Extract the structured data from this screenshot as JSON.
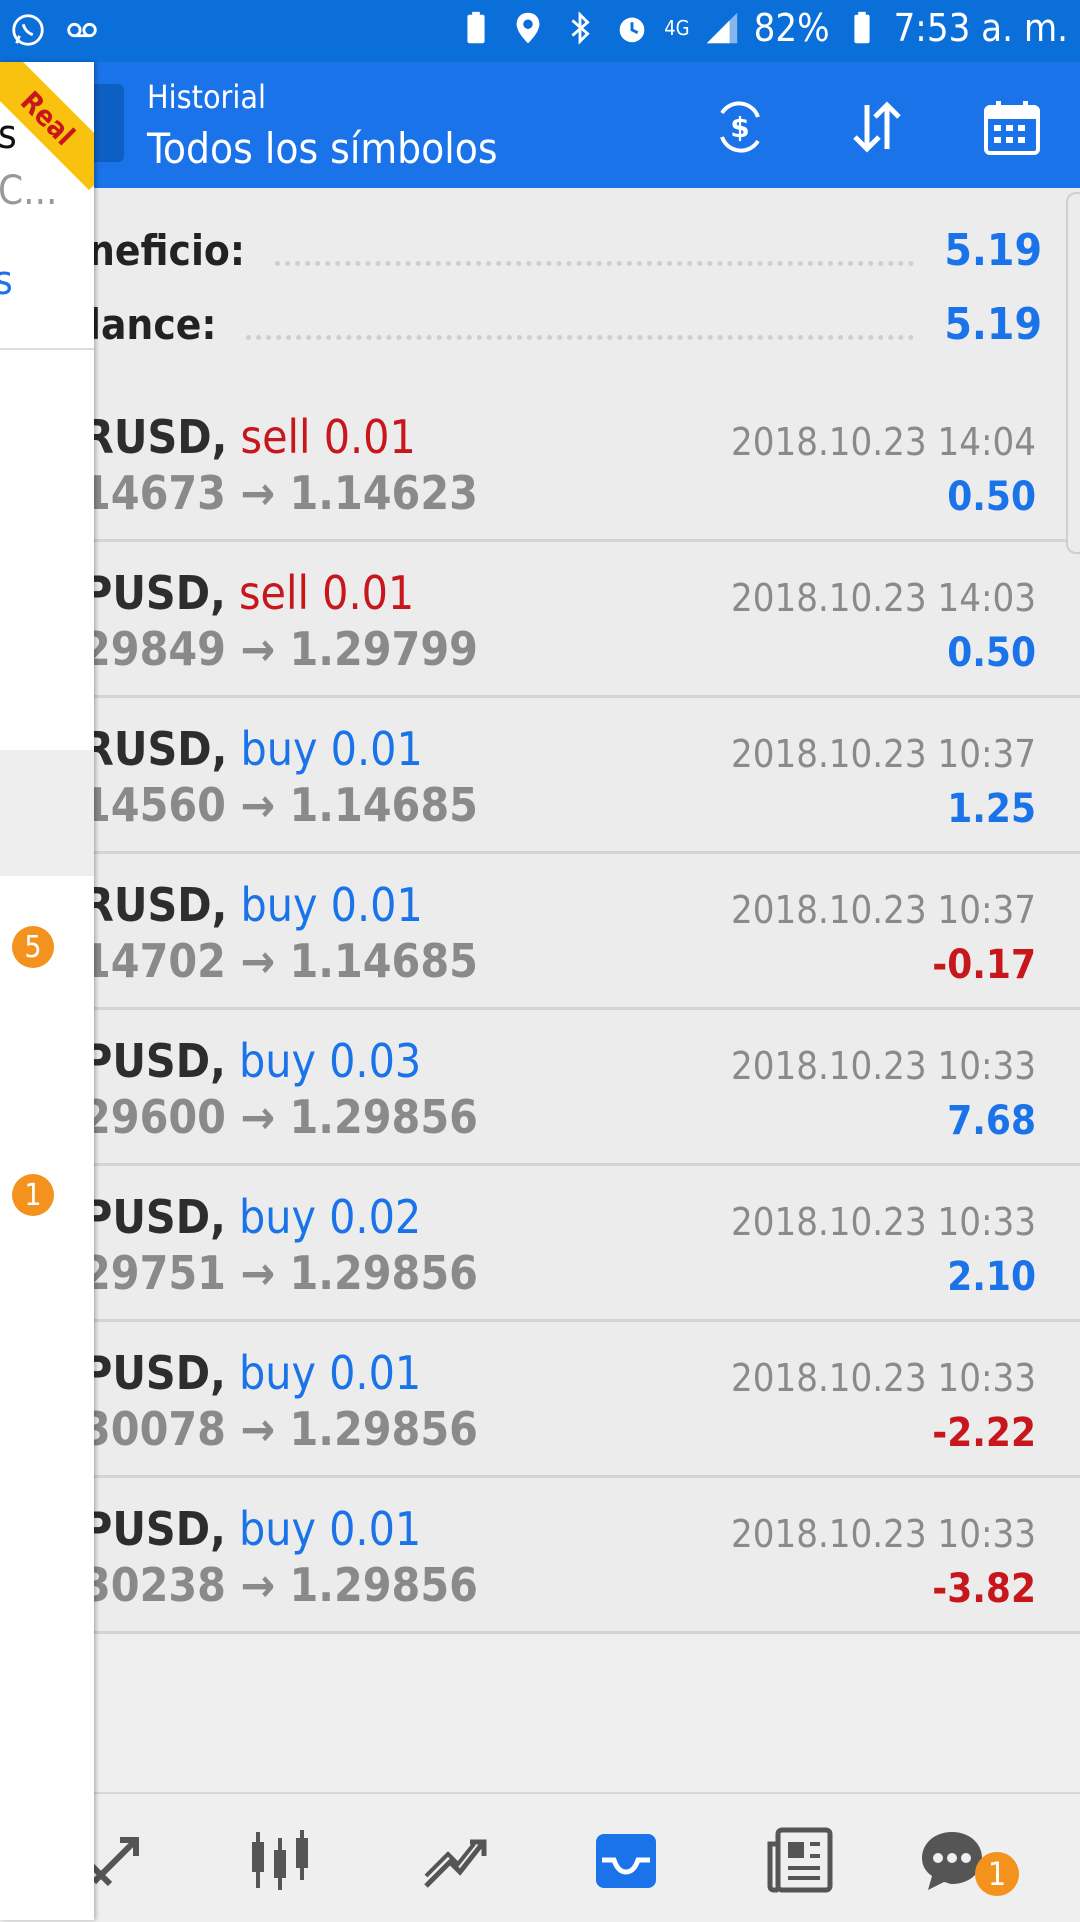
{
  "status_bar": {
    "battery": "82%",
    "time": "7:53 a. m.",
    "network": "4G",
    "icons": [
      "whatsapp-icon",
      "voicemail-icon",
      "battery-saver-icon",
      "location-icon",
      "bluetooth-icon",
      "alarm-icon",
      "network-4g-icon",
      "signal-icon",
      "battery-icon"
    ]
  },
  "app_bar": {
    "title": "Historial",
    "subtitle": "Todos los símbolos",
    "actions": [
      "exchange-icon",
      "sort-icon",
      "calendar-icon"
    ]
  },
  "summary": {
    "profit_label": "neficio:",
    "profit_value": "5.19",
    "balance_label": "lance:",
    "balance_value": "5.19"
  },
  "trades": [
    {
      "pair": "RUSD,",
      "side": "sell 0.01",
      "prices": "14673 → 1.14623",
      "date": "2018.10.23 14:04",
      "profit": "0.50"
    },
    {
      "pair": "PUSD,",
      "side": "sell 0.01",
      "prices": "29849 → 1.29799",
      "date": "2018.10.23 14:03",
      "profit": "0.50"
    },
    {
      "pair": "RUSD,",
      "side": "buy 0.01",
      "prices": "14560 → 1.14685",
      "date": "2018.10.23 10:37",
      "profit": "1.25"
    },
    {
      "pair": "RUSD,",
      "side": "buy 0.01",
      "prices": "14702 → 1.14685",
      "date": "2018.10.23 10:37",
      "profit": "-0.17"
    },
    {
      "pair": "PUSD,",
      "side": "buy 0.03",
      "prices": "29600 → 1.29856",
      "date": "2018.10.23 10:33",
      "profit": "7.68"
    },
    {
      "pair": "PUSD,",
      "side": "buy 0.02",
      "prices": "29751 → 1.29856",
      "date": "2018.10.23 10:33",
      "profit": "2.10"
    },
    {
      "pair": "PUSD,",
      "side": "buy 0.01",
      "prices": "30078 → 1.29856",
      "date": "2018.10.23 10:33",
      "profit": "-2.22"
    },
    {
      "pair": "PUSD,",
      "side": "buy 0.01",
      "prices": "30238 → 1.29856",
      "date": "2018.10.23 10:33",
      "profit": "-3.82"
    }
  ],
  "bottom_nav": {
    "items": [
      "quotes-icon",
      "chart-icon",
      "trade-icon",
      "history-icon",
      "news-icon",
      "chat-icon"
    ],
    "active": "history-icon",
    "chat_badge": "1"
  },
  "drawer": {
    "ribbon": "Real",
    "line1": "s",
    "line2": "C...",
    "link": "s",
    "badge1": "5",
    "badge2": "1"
  },
  "colors": {
    "accent": "#1a73e8",
    "negative": "#c8161d",
    "status_bar": "#0a6fd8",
    "badge": "#f4921e"
  }
}
